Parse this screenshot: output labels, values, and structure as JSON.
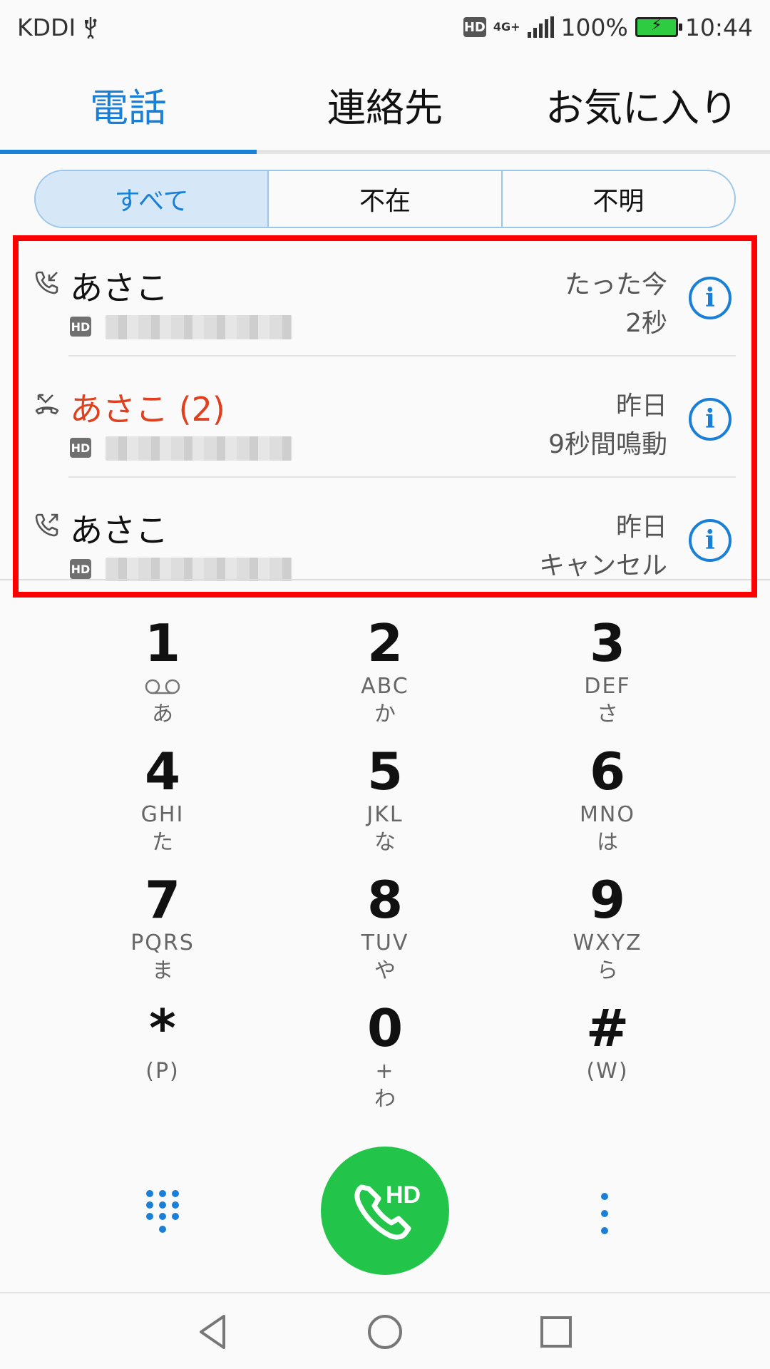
{
  "status_bar": {
    "carrier": "KDDI",
    "usb_icon": "usb-icon",
    "hd_label": "HD",
    "network": "4G+",
    "battery": "100%",
    "time": "10:44"
  },
  "tabs": [
    {
      "label": "電話",
      "active": true
    },
    {
      "label": "連絡先",
      "active": false
    },
    {
      "label": "お気に入り",
      "active": false
    }
  ],
  "filters": [
    {
      "label": "すべて",
      "active": true
    },
    {
      "label": "不在",
      "active": false
    },
    {
      "label": "不明",
      "active": false
    }
  ],
  "calls": [
    {
      "type": "incoming",
      "icon": "incoming-call-icon",
      "name": "あさこ",
      "hd": "HD",
      "time": "たった今",
      "detail": "2秒",
      "missed": false
    },
    {
      "type": "missed",
      "icon": "missed-call-icon",
      "name": "あさこ (2)",
      "hd": "HD",
      "time": "昨日",
      "detail": "9秒間鳴動",
      "missed": true
    },
    {
      "type": "outgoing",
      "icon": "outgoing-call-icon",
      "name": "あさこ",
      "hd": "HD",
      "time": "昨日",
      "detail": "キャンセル",
      "missed": false
    }
  ],
  "dialpad": [
    {
      "digit": "1",
      "letters": "",
      "kana": "あ",
      "voicemail": true
    },
    {
      "digit": "2",
      "letters": "ABC",
      "kana": "か"
    },
    {
      "digit": "3",
      "letters": "DEF",
      "kana": "さ"
    },
    {
      "digit": "4",
      "letters": "GHI",
      "kana": "た"
    },
    {
      "digit": "5",
      "letters": "JKL",
      "kana": "な"
    },
    {
      "digit": "6",
      "letters": "MNO",
      "kana": "は"
    },
    {
      "digit": "7",
      "letters": "PQRS",
      "kana": "ま"
    },
    {
      "digit": "8",
      "letters": "TUV",
      "kana": "や"
    },
    {
      "digit": "9",
      "letters": "WXYZ",
      "kana": "ら"
    },
    {
      "digit": "*",
      "letters": "(P)",
      "kana": ""
    },
    {
      "digit": "0",
      "letters": "+",
      "kana": "わ"
    },
    {
      "digit": "#",
      "letters": "(W)",
      "kana": ""
    }
  ],
  "call_button": {
    "label": "HD",
    "icon": "phone-icon"
  },
  "colors": {
    "accent": "#1a7fd6",
    "missed": "#e0401e",
    "call_green": "#22c54a",
    "highlight": "#ff0000"
  }
}
